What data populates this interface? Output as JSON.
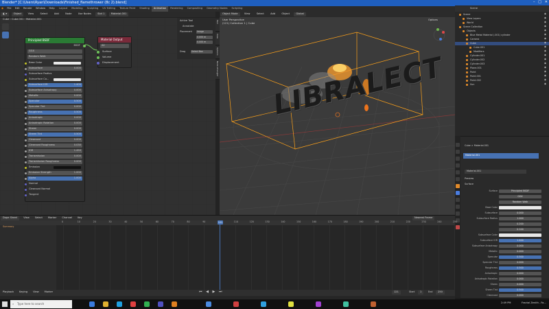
{
  "window": {
    "title": "Blender* [C:\\Users\\Ryan\\Downloads\\Finished_flamethrower (8c 2).blend]",
    "controls": [
      "–",
      "□",
      "✕"
    ]
  },
  "menubar": {
    "menus": [
      "File",
      "Edit",
      "Render",
      "Window",
      "Help"
    ],
    "workspaces": [
      "Layout",
      "Modeling",
      "Sculpting",
      "UV Editing",
      "Texture Paint",
      "Shading",
      "Animation",
      "Rendering",
      "Compositing",
      "Geometry Nodes",
      "Scripting"
    ],
    "active_workspace": "Animation",
    "scene_label": "Scene",
    "view_layer_label": "ViewLayer"
  },
  "node_editor": {
    "header": {
      "object_btn": "Object",
      "view": "View",
      "select": "Select",
      "add": "Add",
      "node": "Node",
      "use_nodes": "Use Nodes",
      "slot": "Slot 1",
      "material": "Material.001"
    },
    "breadcrumb": [
      "Cube",
      "Cube.001",
      "Material.001"
    ],
    "principled": {
      "title": "Principled BSDF",
      "output": "BSDF",
      "dist": "GGX",
      "subsurface_method": "Random Walk",
      "rows": [
        {
          "label": "Base Color",
          "value": "",
          "kind": "color"
        },
        {
          "label": "Subsurface",
          "value": "0.000",
          "kind": "slider"
        },
        {
          "label": "Subsurface Radius",
          "value": "",
          "kind": "vector"
        },
        {
          "label": "Subsurface Co...",
          "value": "",
          "kind": "color"
        },
        {
          "label": "Subsurface IOR",
          "value": "1.400",
          "kind": "blue"
        },
        {
          "label": "Subsurface Anisotropy",
          "value": "0.000",
          "kind": "slider"
        },
        {
          "label": "Metallic",
          "value": "0.000",
          "kind": "slider"
        },
        {
          "label": "Specular",
          "value": "0.500",
          "kind": "blue"
        },
        {
          "label": "Specular Tint",
          "value": "0.000",
          "kind": "slider"
        },
        {
          "label": "Roughness",
          "value": "0.500",
          "kind": "blue"
        },
        {
          "label": "Anisotropic",
          "value": "0.000",
          "kind": "slider"
        },
        {
          "label": "Anisotropic Rotation",
          "value": "0.000",
          "kind": "slider"
        },
        {
          "label": "Sheen",
          "value": "0.000",
          "kind": "slider"
        },
        {
          "label": "Sheen Tint",
          "value": "0.500",
          "kind": "blue"
        },
        {
          "label": "Clearcoat",
          "value": "0.000",
          "kind": "slider"
        },
        {
          "label": "Clearcoat Roughness",
          "value": "0.030",
          "kind": "slider"
        },
        {
          "label": "IOR",
          "value": "1.450",
          "kind": "slider"
        },
        {
          "label": "Transmission",
          "value": "0.000",
          "kind": "slider"
        },
        {
          "label": "Transmission Roughness",
          "value": "0.000",
          "kind": "slider"
        },
        {
          "label": "Emission",
          "value": "",
          "kind": "dark"
        },
        {
          "label": "Emission Strength",
          "value": "1.000",
          "kind": "slider"
        },
        {
          "label": "Alpha",
          "value": "1.000",
          "kind": "blue"
        },
        {
          "label": "Normal",
          "value": "",
          "kind": "socket"
        },
        {
          "label": "Clearcoat Normal",
          "value": "",
          "kind": "socket"
        },
        {
          "label": "Tangent",
          "value": "",
          "kind": "socket"
        }
      ]
    },
    "output_node": {
      "title": "Material Output",
      "target": "All",
      "sockets": [
        "Surface",
        "Volume",
        "Displacement"
      ]
    },
    "npanel": {
      "title": "Active Tool",
      "tool": "Annotate",
      "placement": "Placement",
      "placement_value": "Image",
      "field1": "0.000 m",
      "field2": "0.000 m",
      "drag_label": "Drag",
      "drag_value": "Select Box"
    },
    "side_tabs": [
      "Tool",
      "View",
      "Options",
      "Node Wrangler"
    ]
  },
  "viewport": {
    "mode": "Object Mode",
    "menus": [
      "View",
      "Select",
      "Add",
      "Object"
    ],
    "transform": "Global",
    "info_line1": "User Perspective",
    "info_line2": "(121) Collection 1 | Cube",
    "logo_text": "LIBRALECT",
    "options": "Options"
  },
  "outliner": {
    "title": "Scene",
    "rows": [
      {
        "label": "Scene",
        "indent": 0,
        "sel": false
      },
      {
        "label": "View Layers",
        "indent": 1,
        "sel": false
      },
      {
        "label": "World",
        "indent": 1,
        "sel": false
      },
      {
        "label": "Scene Collection",
        "indent": 0,
        "sel": false
      },
      {
        "label": "Objects",
        "indent": 1,
        "sel": false
      },
      {
        "label": "Blue Metal Material (.001) cylinder",
        "indent": 2,
        "sel": false
      },
      {
        "label": "Camera",
        "indent": 2,
        "sel": false
      },
      {
        "label": "Cube",
        "indent": 2,
        "sel": true
      },
      {
        "label": "Cube.001",
        "indent": 3,
        "sel": false
      },
      {
        "label": "Modifiers",
        "indent": 3,
        "sel": false
      },
      {
        "label": "Cylinder.001",
        "indent": 2,
        "sel": false
      },
      {
        "label": "Cylinder.002",
        "indent": 2,
        "sel": false
      },
      {
        "label": "Cylinder.003",
        "indent": 2,
        "sel": false
      },
      {
        "label": "Plane.001",
        "indent": 2,
        "sel": false
      },
      {
        "label": "Point",
        "indent": 2,
        "sel": false
      },
      {
        "label": "Point.001",
        "indent": 2,
        "sel": false
      },
      {
        "label": "Point.002",
        "indent": 2,
        "sel": false
      },
      {
        "label": "Sun",
        "indent": 2,
        "sel": false
      }
    ]
  },
  "properties": {
    "breadcrumb": "Cube  >  Material.001",
    "slot": "Material.001",
    "material_field": "Material.001",
    "preview": "Preview",
    "surface_section": "Surface",
    "rows": [
      {
        "label": "Surface",
        "value": "Principled BSDF",
        "kind": "plain"
      },
      {
        "label": "",
        "value": "GGX",
        "kind": "plain"
      },
      {
        "label": "",
        "value": "Random Walk",
        "kind": "plain"
      },
      {
        "label": "Base Color",
        "value": "",
        "kind": "white"
      },
      {
        "label": "Subsurface",
        "value": "0.000",
        "kind": "slider"
      },
      {
        "label": "Subsurface Radius",
        "value": "1.000",
        "kind": "slider"
      },
      {
        "label": "",
        "value": "0.200",
        "kind": "slider"
      },
      {
        "label": "",
        "value": "0.100",
        "kind": "slider"
      },
      {
        "label": "Subsurface Color",
        "value": "",
        "kind": "white"
      },
      {
        "label": "Subsurface IOR",
        "value": "1.400",
        "kind": "blue"
      },
      {
        "label": "Subsurface Anisotropy",
        "value": "0.000",
        "kind": "slider"
      },
      {
        "label": "Metallic",
        "value": "0.000",
        "kind": "slider"
      },
      {
        "label": "Specular",
        "value": "0.500",
        "kind": "blue"
      },
      {
        "label": "Specular Tint",
        "value": "0.000",
        "kind": "slider"
      },
      {
        "label": "Roughness",
        "value": "0.500",
        "kind": "blue"
      },
      {
        "label": "Anisotropic",
        "value": "0.000",
        "kind": "slider"
      },
      {
        "label": "Anisotropic Rotation",
        "value": "0.000",
        "kind": "slider"
      },
      {
        "label": "Sheen",
        "value": "0.000",
        "kind": "slider"
      },
      {
        "label": "Sheen Tint",
        "value": "0.500",
        "kind": "blue"
      },
      {
        "label": "Clearcoat",
        "value": "0.000",
        "kind": "slider"
      }
    ]
  },
  "timeline": {
    "editor": "Dope Sheet",
    "menus": [
      "View",
      "Select",
      "Marker",
      "Channel",
      "Key"
    ],
    "summary": "Summary",
    "normalize": "Nearest Frame",
    "ticks": [
      "0",
      "10",
      "20",
      "30",
      "40",
      "50",
      "60",
      "70",
      "80",
      "90",
      "100",
      "110",
      "120",
      "130",
      "140",
      "150",
      "160",
      "170",
      "180",
      "190",
      "200",
      "210",
      "220",
      "230",
      "240",
      "250"
    ],
    "current_frame": "121",
    "playback": [
      "Playback",
      "Keying",
      "View",
      "Marker"
    ],
    "current": "121",
    "start_label": "Start",
    "start": "1",
    "end_label": "End",
    "end": "250"
  },
  "taskbar": {
    "search_placeholder": "Type here to search",
    "time": "2:49 PM",
    "notification": "Fractal Zenith - Fa..."
  },
  "colors": {
    "accent": "#4772b3",
    "node_green": "#2a7a34",
    "node_red": "#7a2a3a",
    "selection": "#ffa31a"
  }
}
